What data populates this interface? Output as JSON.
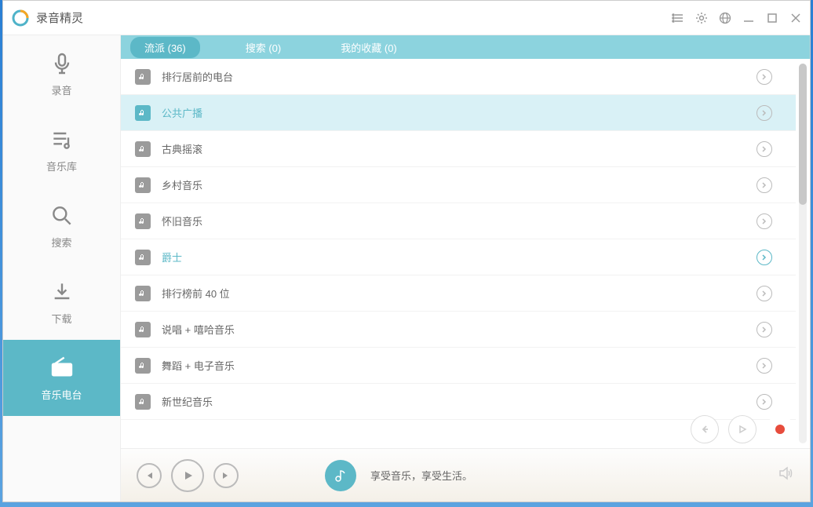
{
  "app": {
    "title": "录音精灵"
  },
  "sidebar": {
    "items": [
      {
        "label": "录音"
      },
      {
        "label": "音乐库"
      },
      {
        "label": "搜索"
      },
      {
        "label": "下载"
      },
      {
        "label": "音乐电台"
      }
    ]
  },
  "tabs": [
    {
      "label": "流派 (36)"
    },
    {
      "label": "搜索 (0)"
    },
    {
      "label": "我的收藏 (0)"
    }
  ],
  "genres": [
    {
      "label": "排行居前的电台"
    },
    {
      "label": "公共广播"
    },
    {
      "label": "古典摇滚"
    },
    {
      "label": "乡村音乐"
    },
    {
      "label": "怀旧音乐"
    },
    {
      "label": "爵士"
    },
    {
      "label": "排行榜前 40 位"
    },
    {
      "label": "说唱 + 嘻哈音乐"
    },
    {
      "label": "舞蹈 + 电子音乐"
    },
    {
      "label": "新世纪音乐"
    }
  ],
  "player": {
    "status": "享受音乐，享受生活。"
  }
}
